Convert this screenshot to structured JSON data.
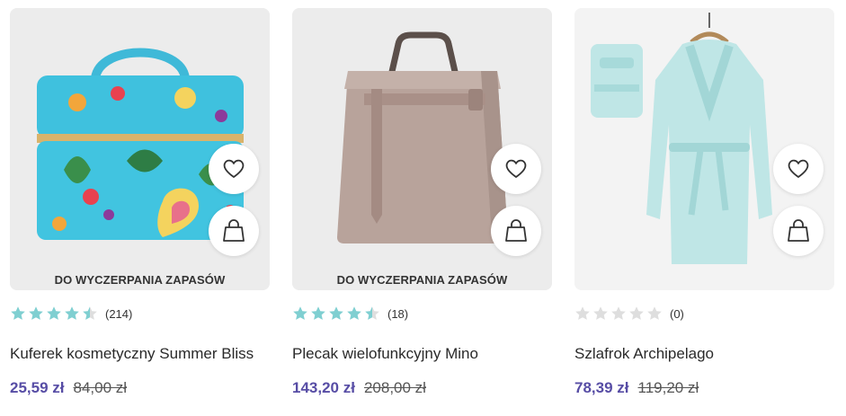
{
  "colors": {
    "star_filled": "#7fcfd1",
    "star_empty": "#dedede",
    "price": "#574da5"
  },
  "products": [
    {
      "badge": "DO WYCZERPANIA ZAPASÓW",
      "rating": 4.5,
      "rating_count": "(214)",
      "name": "Kuferek kosmetyczny Summer Bliss",
      "price": "25,59 zł",
      "old_price": "84,00 zł",
      "image_icon": "cosmetic-case-image"
    },
    {
      "badge": "DO WYCZERPANIA ZAPASÓW",
      "rating": 4.5,
      "rating_count": "(18)",
      "name": "Plecak wielofunkcyjny Mino",
      "price": "143,20 zł",
      "old_price": "208,00 zł",
      "image_icon": "backpack-image"
    },
    {
      "badge": "",
      "rating": 0,
      "rating_count": "(0)",
      "name": "Szlafrok Archipelago",
      "price": "78,39 zł",
      "old_price": "119,20 zł",
      "image_icon": "bathrobe-image"
    }
  ],
  "icons": {
    "favorite": "heart-icon",
    "cart": "shopping-bag-icon",
    "star": "star-icon"
  }
}
